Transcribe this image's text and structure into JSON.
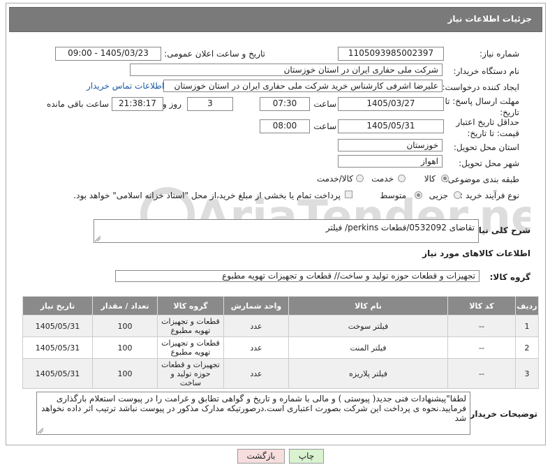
{
  "header": {
    "title": "جزئیات اطلاعات نیاز"
  },
  "fields": {
    "need_number_label": "شماره نیاز:",
    "need_number": "1105093985002397",
    "announce_label": "تاریخ و ساعت اعلان عمومی:",
    "announce_value": "1405/03/23 - 09:00",
    "buyer_label": "نام دستگاه خریدار:",
    "buyer_value": "شرکت ملی حفاری ایران در استان خوزستان",
    "creator_label": "ایجاد کننده درخواست:",
    "creator_value": "علیرضا اشرفی کارشناس خرید شرکت ملی حفاری ایران در استان خوزستان",
    "contact_link": "اطلاعات تماس خریدار",
    "deadline_label": "مهلت ارسال پاسخ: تا تاریخ:",
    "deadline_date": "1405/03/27",
    "time_label": "ساعت",
    "deadline_time": "07:30",
    "days_value": "3",
    "days_label": "روز و",
    "remaining_time": "21:38:17",
    "remaining_label": "ساعت باقی مانده",
    "validity_label": "حداقل تاریخ اعتبار قیمت: تا تاریخ:",
    "validity_date": "1405/05/31",
    "validity_time": "08:00",
    "province_label": "استان محل تحویل:",
    "province_value": "خوزستان",
    "city_label": "شهر محل تحویل:",
    "city_value": "اهواز",
    "category_label": "طبقه بندی موضوعی:",
    "cat_goods": "کالا",
    "cat_service": "خدمت",
    "cat_both": "کالا/خدمت",
    "process_label": "نوع فرآیند خرید :",
    "proc_partial": "جزیی",
    "proc_medium": "متوسط",
    "payment_note": "پرداخت تمام یا بخشی از مبلغ خرید،از محل \"اسناد خزانه اسلامی\" خواهد بود."
  },
  "description": {
    "label": "شرح کلی نیاز:",
    "value": "تقاضای 0532092/قطعات perkins/ فیلتر"
  },
  "goods_section": {
    "title": "اطلاعات کالاهای مورد نیاز",
    "group_label": "گروه کالا:",
    "group_value": "تجهیزات و قطعات حوزه تولید و ساخت//  قطعات و تجهیزات تهویه مطبوع"
  },
  "table": {
    "headers": [
      "ردیف",
      "کد کالا",
      "نام کالا",
      "واحد شمارش",
      "گروه کالا",
      "تعداد / مقدار",
      "تاریخ نیاز"
    ],
    "rows": [
      [
        "1",
        "--",
        "فیلتر سوخت",
        "عدد",
        "قطعات و تجهیزات تهویه مطبوع",
        "100",
        "1405/05/31"
      ],
      [
        "2",
        "--",
        "فیلتر المنت",
        "عدد",
        "قطعات و تجهیزات تهویه مطبوع",
        "100",
        "1405/05/31"
      ],
      [
        "3",
        "--",
        "فیلتر پلاریزه",
        "عدد",
        "تجهیزات و قطعات حوزه تولید و ساخت",
        "100",
        "1405/05/31"
      ]
    ]
  },
  "buyer_notes": {
    "label": "توضیحات خریدار:",
    "value": "لطفا\"پیشنهادات فنی جدید( پیوستی ) و مالی با شماره و تاریخ و گواهی تطابق و غرامت را در پیوست استعلام بارگذاری فرمایید.نحوه ی پرداخت این شرکت بصورت اعتباری است.درصورتیکه مدارک مذکور در پیوست نباشد ترتیب اثر داده نخواهد شد"
  },
  "buttons": {
    "print": "چاپ",
    "back": "بازگشت"
  },
  "watermark": "AriaTender.net",
  "colors": {
    "title_bar": "#7a7a7a",
    "link": "#1a5aa6",
    "print_btn": "#d9f2d0",
    "back_btn": "#f7dede"
  }
}
